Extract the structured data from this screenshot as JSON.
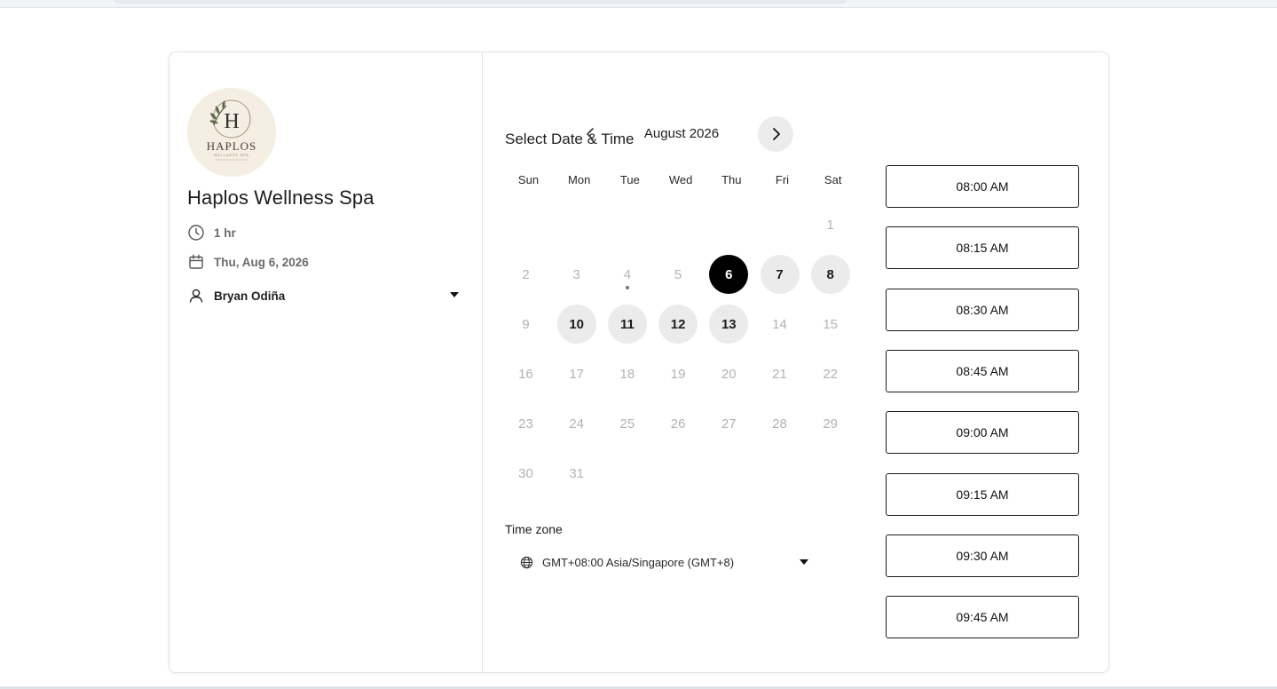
{
  "business": {
    "name": "Haplos Wellness Spa",
    "logo_text": "HAPLOS",
    "logo_subtext": "WELLNESS SPA",
    "duration": "1 hr",
    "date": "Thu, Aug 6, 2026",
    "staff": "Bryan Odiña"
  },
  "scheduler": {
    "heading": "Select Date & Time",
    "month_label": "August 2026",
    "weekdays": [
      "Sun",
      "Mon",
      "Tue",
      "Wed",
      "Thu",
      "Fri",
      "Sat"
    ],
    "days": [
      {
        "label": "1",
        "state": "unavailable"
      },
      {
        "label": "2",
        "state": "unavailable"
      },
      {
        "label": "3",
        "state": "unavailable"
      },
      {
        "label": "4",
        "state": "unavailable",
        "today": true
      },
      {
        "label": "5",
        "state": "unavailable"
      },
      {
        "label": "6",
        "state": "selected"
      },
      {
        "label": "7",
        "state": "available"
      },
      {
        "label": "8",
        "state": "available"
      },
      {
        "label": "9",
        "state": "unavailable"
      },
      {
        "label": "10",
        "state": "available"
      },
      {
        "label": "11",
        "state": "available"
      },
      {
        "label": "12",
        "state": "available"
      },
      {
        "label": "13",
        "state": "available"
      },
      {
        "label": "14",
        "state": "unavailable"
      },
      {
        "label": "15",
        "state": "unavailable"
      },
      {
        "label": "16",
        "state": "unavailable"
      },
      {
        "label": "17",
        "state": "unavailable"
      },
      {
        "label": "18",
        "state": "unavailable"
      },
      {
        "label": "19",
        "state": "unavailable"
      },
      {
        "label": "20",
        "state": "unavailable"
      },
      {
        "label": "21",
        "state": "unavailable"
      },
      {
        "label": "22",
        "state": "unavailable"
      },
      {
        "label": "23",
        "state": "unavailable"
      },
      {
        "label": "24",
        "state": "unavailable"
      },
      {
        "label": "25",
        "state": "unavailable"
      },
      {
        "label": "26",
        "state": "unavailable"
      },
      {
        "label": "27",
        "state": "unavailable"
      },
      {
        "label": "28",
        "state": "unavailable"
      },
      {
        "label": "29",
        "state": "unavailable"
      },
      {
        "label": "30",
        "state": "unavailable"
      },
      {
        "label": "31",
        "state": "unavailable"
      }
    ],
    "timezone_label": "Time zone",
    "timezone_value": "GMT+08:00 Asia/Singapore (GMT+8)"
  },
  "time_slots": [
    "08:00 AM",
    "08:15 AM",
    "08:30 AM",
    "08:45 AM",
    "09:00 AM",
    "09:15 AM",
    "09:30 AM",
    "09:45 AM"
  ],
  "icons": {
    "duration": "clock-icon",
    "date": "calendar-icon",
    "staff": "user-icon",
    "prev": "chevron-left-icon",
    "next": "chevron-right-icon",
    "timezone": "globe-icon"
  },
  "colors": {
    "selected_day": "#000000",
    "available_day": "#ebebeb",
    "unavailable_text": "#b3b3b3",
    "logo_bg": "#f5eee3"
  }
}
